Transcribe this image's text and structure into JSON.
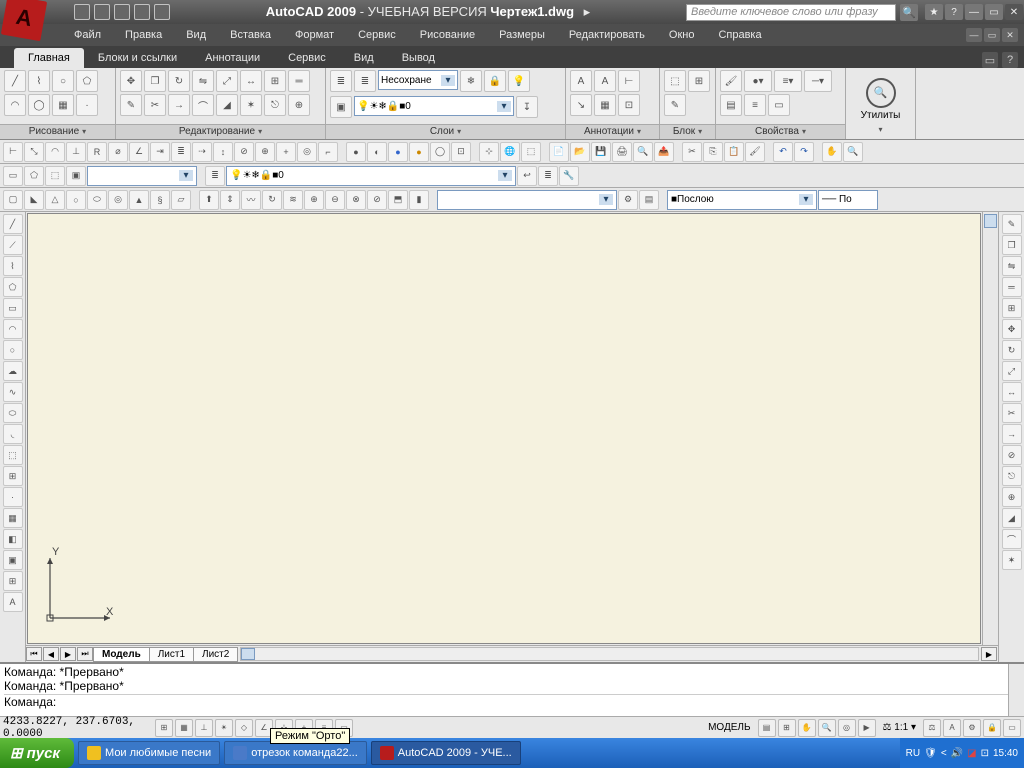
{
  "title_app": "AutoCAD 2009",
  "title_suffix": " - УЧЕБНАЯ ВЕРСИЯ ",
  "title_doc": "Чертеж1.dwg",
  "search_placeholder": "Введите ключевое слово или фразу",
  "menu": [
    "Файл",
    "Правка",
    "Вид",
    "Вставка",
    "Формат",
    "Сервис",
    "Рисование",
    "Размеры",
    "Редактировать",
    "Окно",
    "Справка"
  ],
  "ribbon_tabs": [
    "Главная",
    "Блоки и ссылки",
    "Аннотации",
    "Сервис",
    "Вид",
    "Вывод"
  ],
  "ribbon_active": 0,
  "panels": {
    "draw": "Рисование",
    "edit": "Редактирование",
    "layers": "Слои",
    "annot": "Аннотации",
    "block": "Блок",
    "props": "Свойства",
    "utils": "Утилиты"
  },
  "layer_combo": "Несохране",
  "layer_row2": "0",
  "layers_toolbar_value": "0",
  "bylayer_combo": "Послою",
  "layout_tabs": [
    "Модель",
    "Лист1",
    "Лист2"
  ],
  "layout_active": 0,
  "command_lines": [
    "Команда: *Прервано*",
    "Команда: *Прервано*",
    "",
    "Команда:"
  ],
  "coords": "4233.8227, 237.6703, 0.0000",
  "tooltip": "Режим \"Орто\"",
  "status_model": "МОДЕЛЬ",
  "status_scale": "1:1",
  "taskbar": {
    "start": "пуск",
    "buttons": [
      "Мои любимые песни",
      "отрезок команда22...",
      "AutoCAD 2009 - УЧЕ..."
    ],
    "active": 2,
    "lang": "RU",
    "clock": "15:40"
  },
  "ucs": {
    "x": "X",
    "y": "Y"
  }
}
